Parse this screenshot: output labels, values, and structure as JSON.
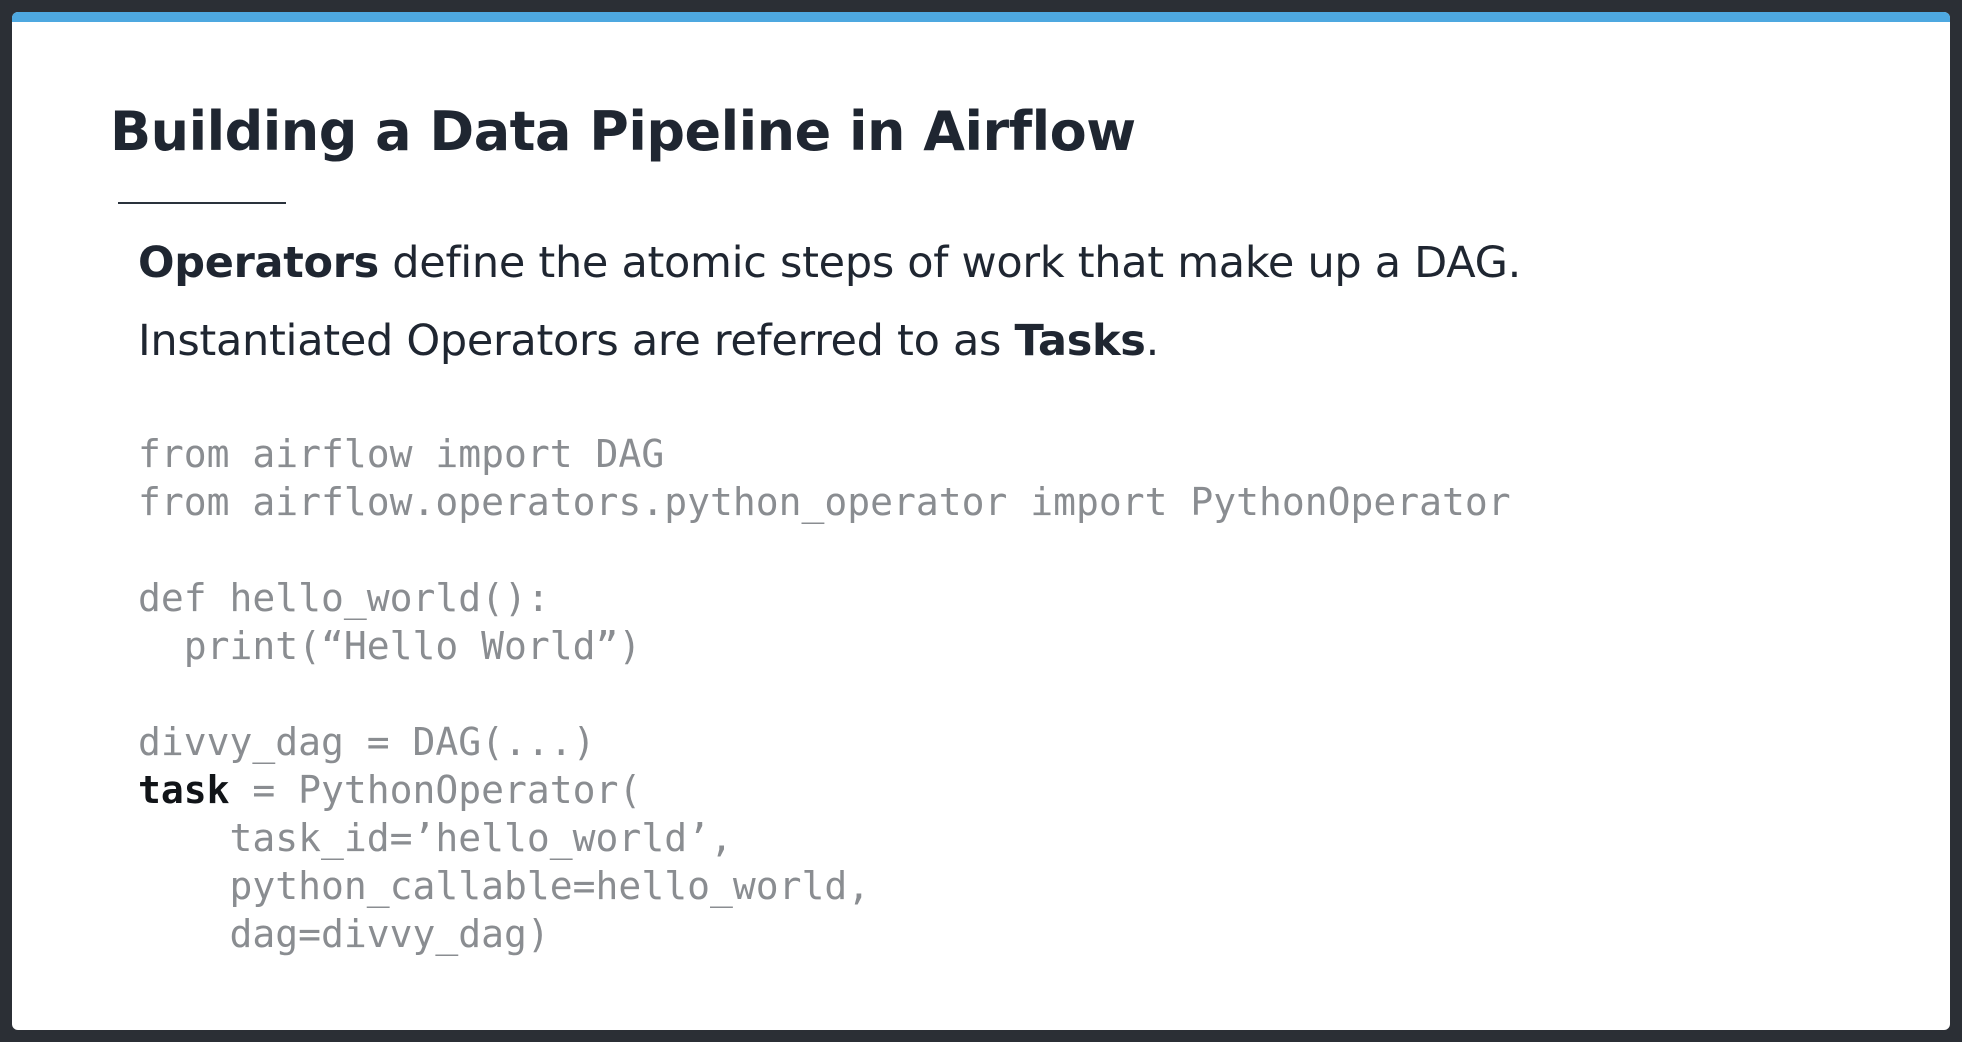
{
  "slide": {
    "title": "Building a Data Pipeline in Airflow",
    "paragraph1": {
      "bold": "Operators",
      "rest": " define the atomic steps of work that make up a DAG."
    },
    "paragraph2": {
      "before": "Instantiated Operators are referred to as ",
      "bold": "Tasks",
      "after": "."
    },
    "code": {
      "line1": "from airflow import DAG",
      "line2": "from airflow.operators.python_operator import PythonOperator",
      "line3": "",
      "line4": "def hello_world():",
      "line5": "  print(“Hello World”)",
      "line6": "",
      "line7": "divvy_dag = DAG(...)",
      "line8_bold": "task",
      "line8_rest": " = PythonOperator(",
      "line9": "    task_id=’hello_world’,",
      "line10": "    python_callable=hello_world,",
      "line11": "    dag=divvy_dag)"
    }
  },
  "colors": {
    "accent": "#4ea8e0",
    "title": "#1f2631",
    "code": "#8a8d91"
  }
}
